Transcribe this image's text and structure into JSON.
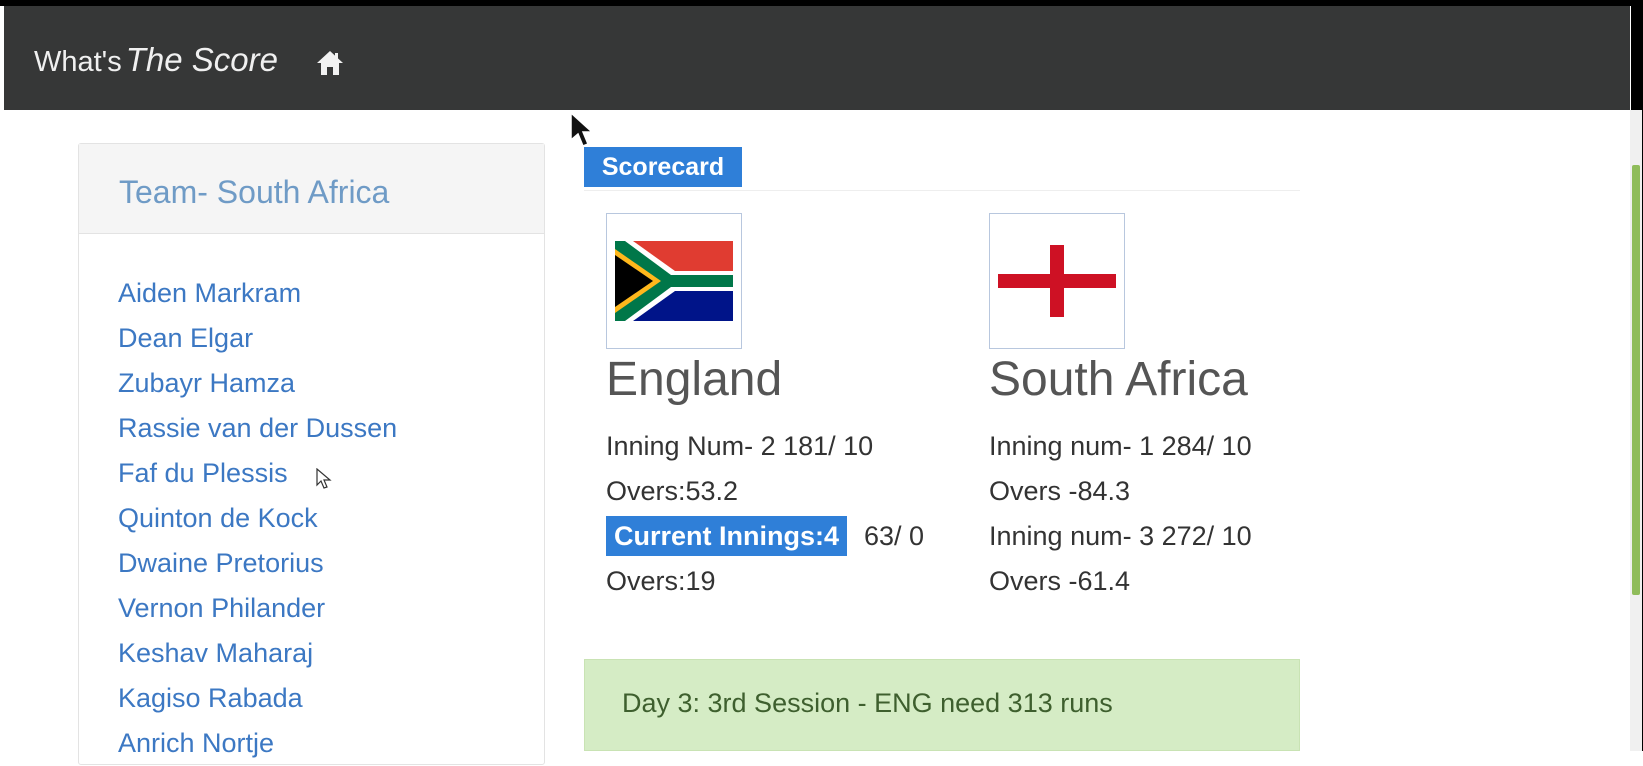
{
  "navbar": {
    "brand_plain": "What's",
    "brand_em": "The Score",
    "home_icon": "home-icon"
  },
  "sidebar": {
    "title": "Team- South Africa",
    "players": [
      "Aiden Markram",
      "Dean Elgar",
      "Zubayr Hamza",
      "Rassie van der Dussen",
      "Faf du Plessis",
      "Quinton de Kock",
      "Dwaine Pretorius",
      "Vernon Philander",
      "Keshav Maharaj",
      "Kagiso Rabada",
      "Anrich Nortje"
    ]
  },
  "scorecard": {
    "badge": "Scorecard",
    "england": {
      "flag": "south-africa-flag",
      "name": "England",
      "inning_line": "Inning Num- 2 181/ 10",
      "overs_line": "Overs:53.2",
      "current_label": "Current Innings:4",
      "current_score": "63/ 0",
      "current_overs": "Overs:19"
    },
    "south_africa": {
      "flag": "england-flag",
      "name": "South Africa",
      "inning1_line": "Inning num- 1 284/ 10",
      "overs1_line": "Overs -84.3",
      "inning3_line": "Inning num- 3 272/ 10",
      "overs3_line": "Overs -61.4"
    },
    "session": "Day 3: 3rd Session - ENG need 313 runs"
  },
  "colors": {
    "navbar_bg": "#363737",
    "accent_blue": "#2f7fd8",
    "link_blue": "#3c78c3",
    "alert_green": "#d5ecc5"
  }
}
